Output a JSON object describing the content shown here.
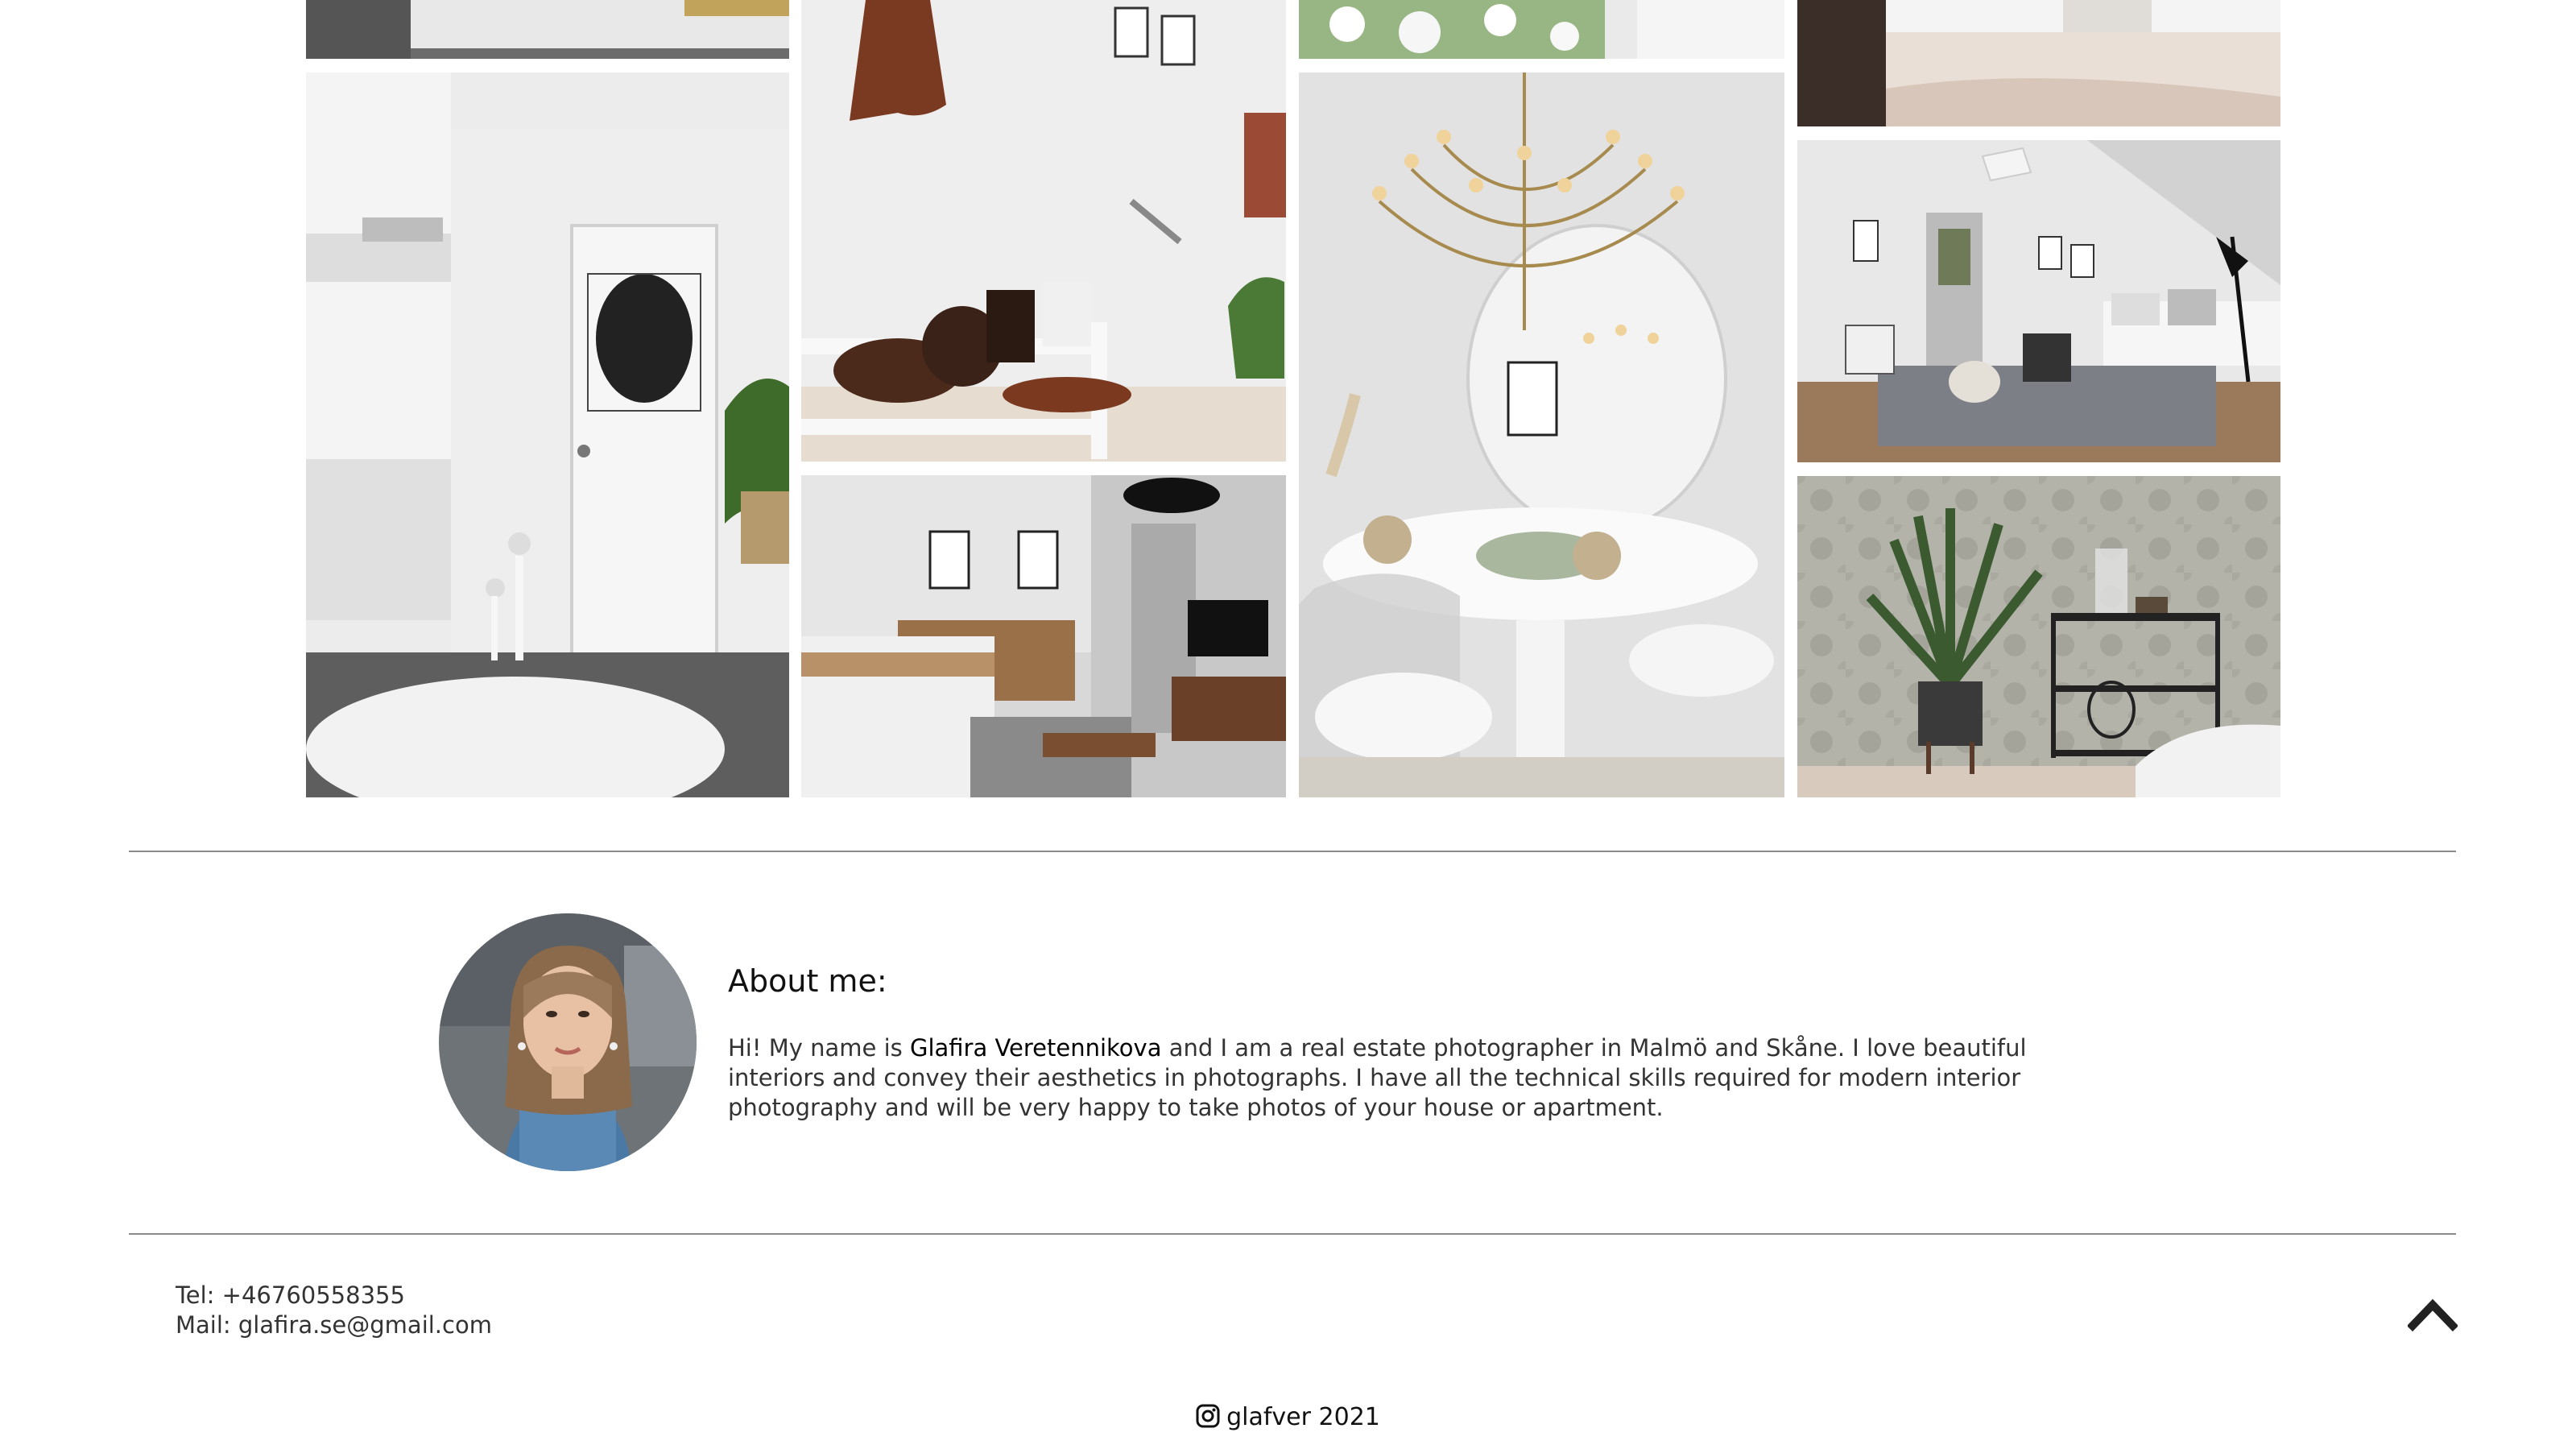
{
  "gallery": {
    "photos": [
      {
        "name": "kitchen-photo-top",
        "colors": [
          "#d9d9d9",
          "#6b6b6b"
        ]
      },
      {
        "name": "hallway-door-photo",
        "colors": [
          "#e9e9e9",
          "#5a5a5a"
        ]
      },
      {
        "name": "shoe-rack-photo",
        "colors": [
          "#ececec",
          "#7a4a33"
        ]
      },
      {
        "name": "living-room-photo",
        "colors": [
          "#dcdcdc",
          "#8a6a48"
        ]
      },
      {
        "name": "flowers-photo-top",
        "colors": [
          "#eaeaea",
          "#7c9b6a"
        ]
      },
      {
        "name": "dining-chandelier-photo",
        "colors": [
          "#e4e4e4",
          "#b89a5a"
        ]
      },
      {
        "name": "bedroom-photo-top",
        "colors": [
          "#efe9e4",
          "#4a3b34"
        ]
      },
      {
        "name": "lounge-sofa-photo",
        "colors": [
          "#e6e6e6",
          "#7a7a7a"
        ]
      },
      {
        "name": "plant-wallpaper-photo",
        "colors": [
          "#b8b8b0",
          "#3c4a38"
        ]
      }
    ]
  },
  "about": {
    "title": "About me:",
    "intro": "Hi! My name is ",
    "name": "Glafira Veretennikova",
    "body": " and I am a real estate photographer in Malmö and Skåne. I love beautiful interiors and convey their aesthetics in photographs. I have all the technical skills required for modern interior photography and will be very happy to take photos of your house or apartment."
  },
  "contact": {
    "tel": "Tel: +46760558355",
    "mail": "Mail: glafira.se@gmail.com"
  },
  "footer": {
    "social": "glafver 2021",
    "icon": "instagram-icon"
  },
  "icons": {
    "back_to_top": "chevron-up-icon"
  },
  "colors": {
    "divider": "#8a8a8a",
    "text": "#333333"
  }
}
